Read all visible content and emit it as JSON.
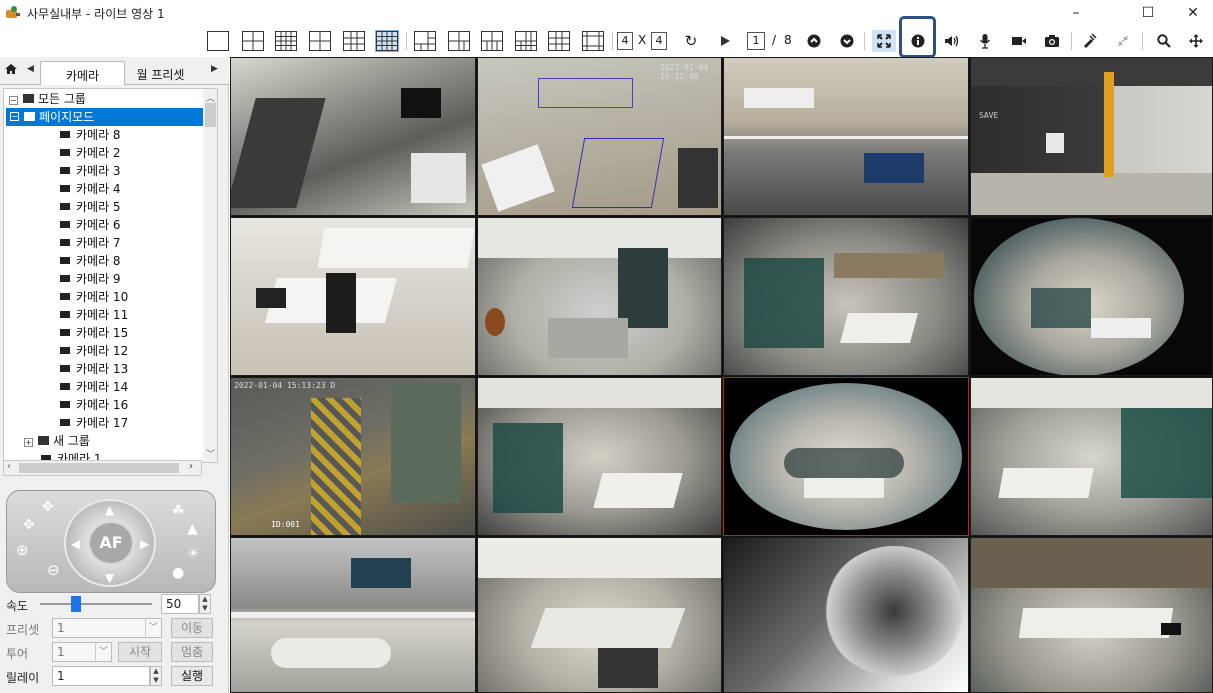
{
  "window": {
    "title": "사무실내부 - 라이브 영상 1",
    "controls": [
      "–",
      "☐",
      "✕"
    ]
  },
  "toolbar": {
    "grid_rows": "4",
    "grid_x": "X",
    "grid_cols": "4",
    "page_current": "1",
    "page_sep": "/",
    "page_total": "8",
    "icons": [
      "refresh-icon",
      "play-icon",
      "page-up-icon",
      "page-down-icon",
      "fullscreen-icon",
      "info-icon",
      "speaker-icon",
      "microphone-icon",
      "record-icon",
      "snapshot-icon",
      "ptz-off-icon",
      "disconnect-icon",
      "zoom-icon",
      "move-icon"
    ]
  },
  "sidebar": {
    "tabs": [
      "카메라",
      "월 프리셋"
    ],
    "tree": [
      {
        "label": "모든 그룹",
        "type": "group",
        "level": 0
      },
      {
        "label": "페이지모드",
        "type": "group",
        "level": 1,
        "selected": true
      },
      {
        "label": "카메라 8",
        "type": "camera",
        "level": 2
      },
      {
        "label": "카메라 2",
        "type": "camera",
        "level": 2
      },
      {
        "label": "카메라 3",
        "type": "camera",
        "level": 2
      },
      {
        "label": "카메라 4",
        "type": "camera",
        "level": 2
      },
      {
        "label": "카메라 5",
        "type": "camera",
        "level": 2
      },
      {
        "label": "카메라 6",
        "type": "camera",
        "level": 2
      },
      {
        "label": "카메라 7",
        "type": "camera",
        "level": 2
      },
      {
        "label": "카메라 8",
        "type": "camera",
        "level": 2
      },
      {
        "label": "카메라 9",
        "type": "camera",
        "level": 2
      },
      {
        "label": "카메라 10",
        "type": "camera",
        "level": 2
      },
      {
        "label": "카메라 11",
        "type": "camera",
        "level": 2
      },
      {
        "label": "카메라 15",
        "type": "camera",
        "level": 2
      },
      {
        "label": "카메라 12",
        "type": "camera",
        "level": 2
      },
      {
        "label": "카메라 13",
        "type": "camera",
        "level": 2
      },
      {
        "label": "카메라 14",
        "type": "camera",
        "level": 2
      },
      {
        "label": "카메라 16",
        "type": "camera",
        "level": 2
      },
      {
        "label": "카메라 17",
        "type": "camera",
        "level": 2
      },
      {
        "label": "새 그룹",
        "type": "group",
        "level": 1
      },
      {
        "label": "카메라 1",
        "type": "camera",
        "level": 1
      }
    ]
  },
  "ptz": {
    "af_label": "AF"
  },
  "controls": {
    "speed_label": "속도",
    "speed_value": "50",
    "speed_level": 0.32,
    "preset_label": "프리셋",
    "preset_value": "1",
    "move_btn": "이동",
    "tour_label": "투어",
    "tour_value": "1",
    "start_btn": "시작",
    "stop_btn": "멈춤",
    "relay_label": "릴레이",
    "relay_value": "1",
    "run_btn": "실행"
  },
  "video": {
    "tile_osd": {
      "t2": "2022-01-04 15:12:40",
      "t9": "2022-01-04 15:13:23 D",
      "t9b": "ID:001",
      "t4": "SAVE"
    },
    "colors": {
      "selected_border": "#c02020",
      "highlight": "#2b4f86",
      "tree_selected": "#0078d7"
    }
  }
}
